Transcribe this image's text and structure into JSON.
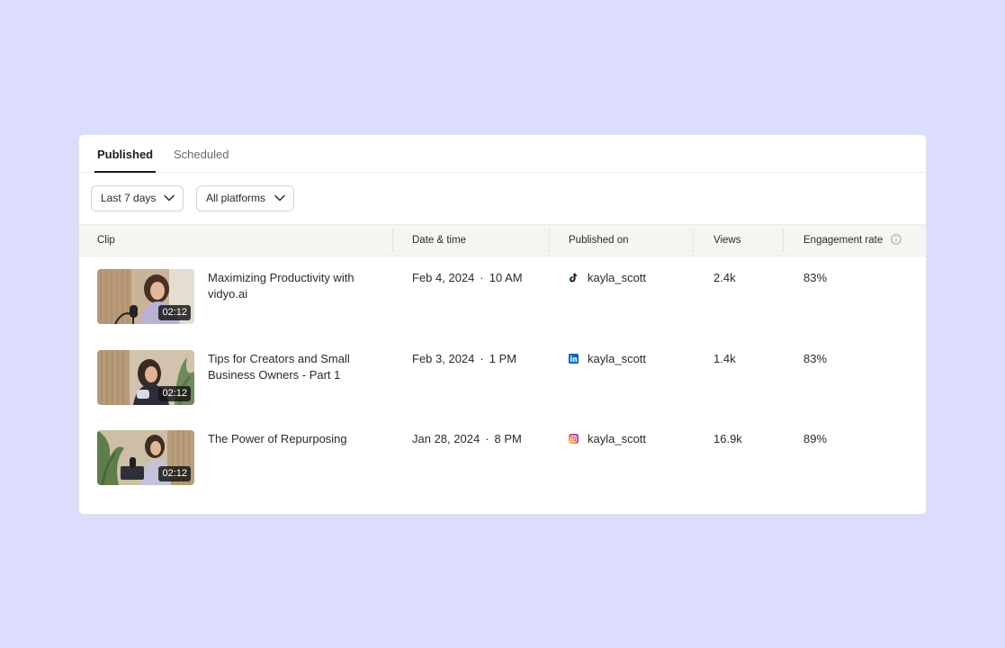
{
  "tabs": {
    "published": "Published",
    "scheduled": "Scheduled"
  },
  "filters": {
    "date_range": "Last 7 days",
    "platforms": "All platforms"
  },
  "columns": {
    "clip": "Clip",
    "date_time": "Date & time",
    "published_on": "Published on",
    "views": "Views",
    "engagement_rate": "Engagement rate"
  },
  "rows": [
    {
      "title": "Maximizing Productivity with vidyo.ai",
      "duration": "02:12",
      "date": "Feb 4, 2024",
      "time": "10 AM",
      "platform_icon": "tiktok-icon",
      "account": "kayla_scott",
      "views": "2.4k",
      "engagement": "83%"
    },
    {
      "title": "Tips for Creators and Small Business Owners - Part 1",
      "duration": "02:12",
      "date": "Feb 3, 2024",
      "time": "1 PM",
      "platform_icon": "linkedin-icon",
      "account": "kayla_scott",
      "views": "1.4k",
      "engagement": "83%"
    },
    {
      "title": "The Power of Repurposing",
      "duration": "02:12",
      "date": "Jan 28, 2024",
      "time": "8 PM",
      "platform_icon": "instagram-icon",
      "account": "kayla_scott",
      "views": "16.9k",
      "engagement": "89%"
    }
  ],
  "date_separator": "·",
  "colors": {
    "page_background": "#dcdcfc",
    "header_background": "#f5f5f2",
    "linkedin": "#0a66c2",
    "tiktok": "#111111"
  }
}
